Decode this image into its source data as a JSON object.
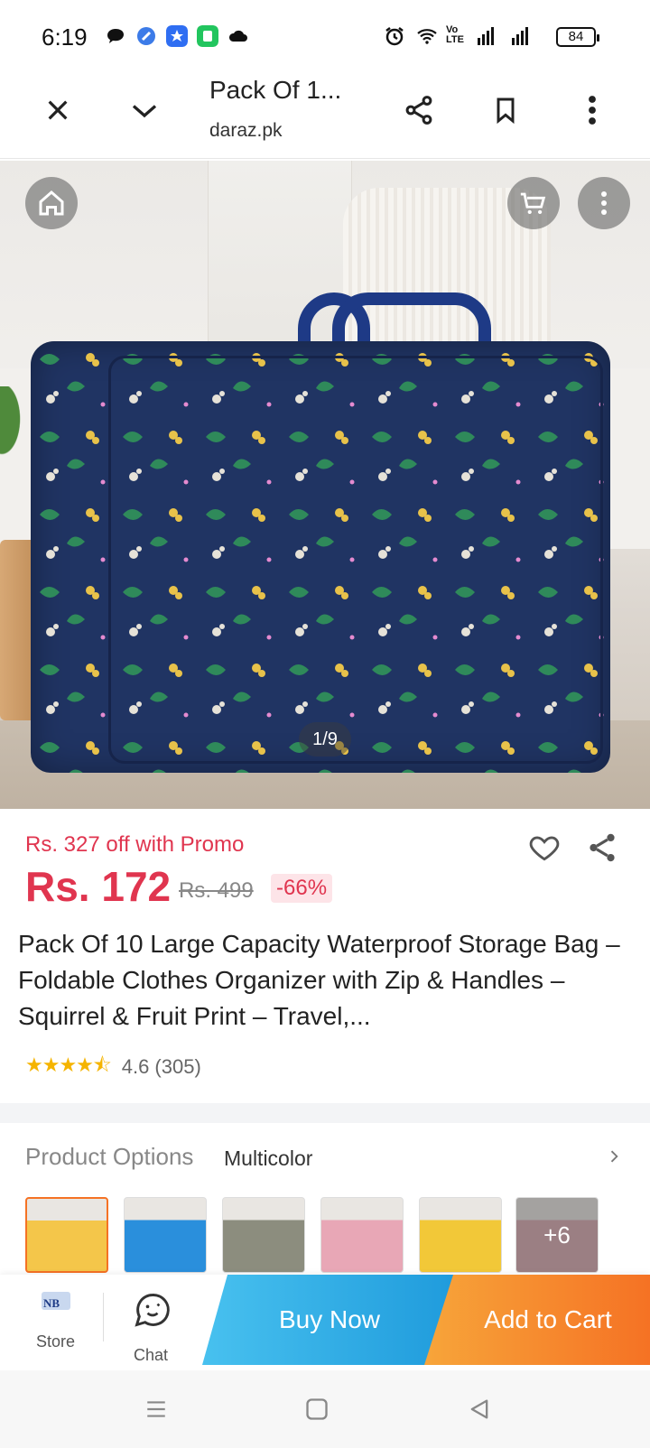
{
  "status_bar": {
    "time": "6:19",
    "network_label": "Vo LTE",
    "battery": "84"
  },
  "browser": {
    "page_title": "Pack Of 1...",
    "domain": "daraz.pk",
    "icons": [
      "close-icon",
      "chevron-down-icon",
      "share-icon",
      "bookmark-icon",
      "more-vert-icon"
    ]
  },
  "gallery": {
    "counter": "1/9",
    "icons": [
      "home-icon",
      "cart-icon",
      "more-vert-icon"
    ]
  },
  "product": {
    "promo_text": "Rs. 327 off with Promo",
    "price": "Rs. 172",
    "original_price": "Rs. 499",
    "discount": "-66%",
    "title": "Pack Of 10 Large Capacity Waterproof Storage Bag – Foldable Clothes Organizer with Zip & Handles – Squirrel & Fruit Print – Travel,...",
    "rating_value": 4.6,
    "rating_text": "4.6 (305)"
  },
  "options": {
    "label": "Product Options",
    "value": "Multicolor",
    "more_count": "+6",
    "thumb_colors": [
      "#f4c64a",
      "#2a8fdc",
      "#8c8d7e",
      "#e8a7b6",
      "#f2c838",
      "#d9a7ae"
    ]
  },
  "actions": {
    "store_label": "Store",
    "store_logo_text": "NB",
    "chat_label": "Chat",
    "buy_now": "Buy Now",
    "add_to_cart": "Add to Cart"
  },
  "colors": {
    "price_red": "#e0354f",
    "buy_now_blue": "#2aaae6",
    "add_cart_orange": "#f57224",
    "bag_navy": "#203463"
  }
}
